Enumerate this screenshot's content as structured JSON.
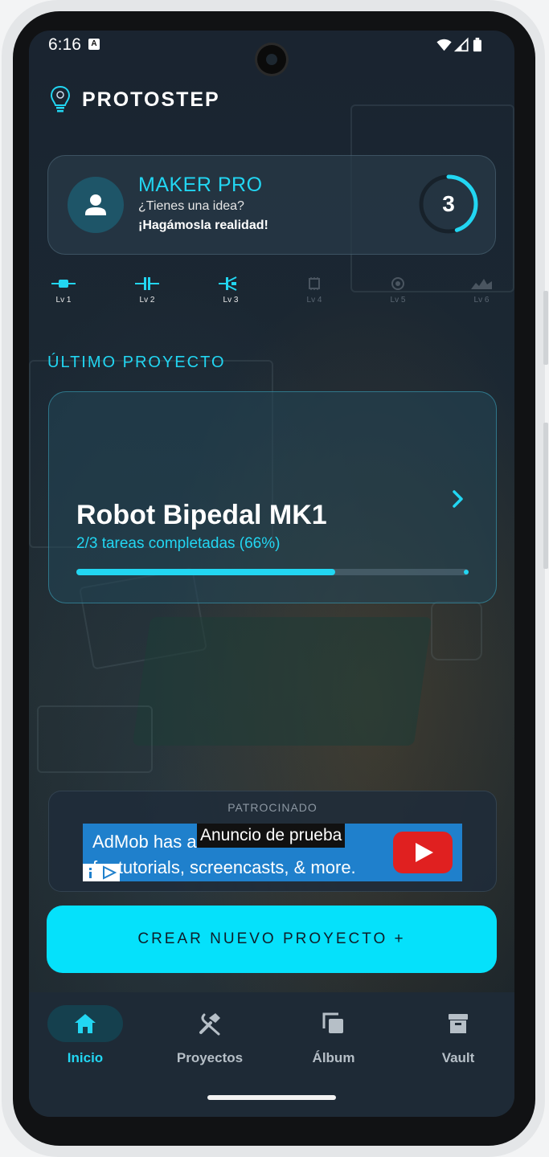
{
  "status_bar": {
    "time": "6:16",
    "notification_badge": "A"
  },
  "app": {
    "brand": "PROTOSTEP",
    "accent_color": "#22d6f2"
  },
  "profile": {
    "title": "MAKER PRO",
    "subtitle": "¿Tienes una idea?",
    "tagline": "¡Hagámosla realidad!",
    "level": "3",
    "level_progress": 0.45
  },
  "levels": [
    {
      "label": "Lv 1",
      "unlocked": true
    },
    {
      "label": "Lv 2",
      "unlocked": true
    },
    {
      "label": "Lv 3",
      "unlocked": true
    },
    {
      "label": "Lv 4",
      "unlocked": false
    },
    {
      "label": "Lv 5",
      "unlocked": false
    },
    {
      "label": "Lv 6",
      "unlocked": false
    }
  ],
  "last_project": {
    "section_title": "ÚLTIMO PROYECTO",
    "name": "Robot Bipedal MK1",
    "progress_text": "2/3 tareas completadas (66%)",
    "progress": 0.66
  },
  "ad": {
    "label": "PATROCINADO",
    "line1": "AdMob has a",
    "line2": "for tutorials, screencasts, & more.",
    "test_label": "Anuncio de prueba"
  },
  "create_button": {
    "label": "CREAR NUEVO PROYECTO  +"
  },
  "bottom_nav": [
    {
      "label": "Inicio",
      "icon": "home-icon",
      "active": true
    },
    {
      "label": "Proyectos",
      "icon": "tools-icon",
      "active": false
    },
    {
      "label": "Álbum",
      "icon": "album-icon",
      "active": false
    },
    {
      "label": "Vault",
      "icon": "archive-icon",
      "active": false
    }
  ]
}
